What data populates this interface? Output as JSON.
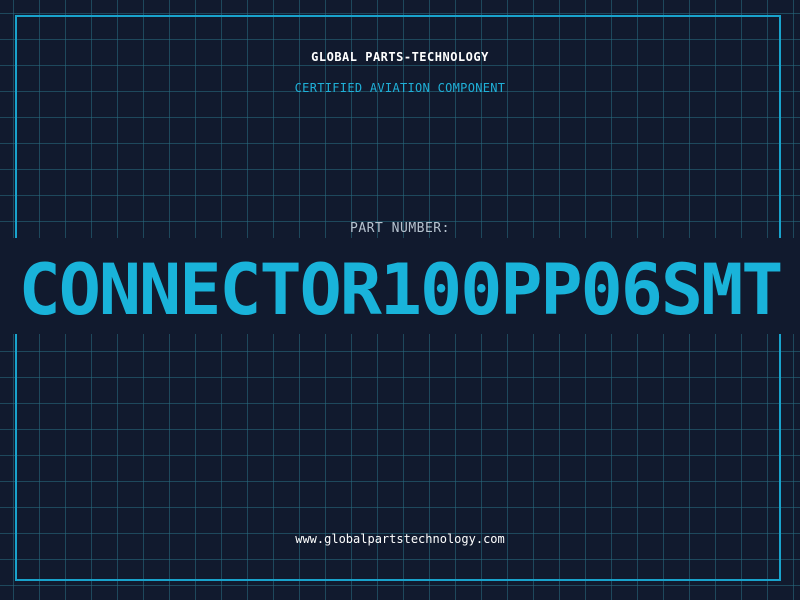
{
  "header": {
    "company": "GLOBAL PARTS-TECHNOLOGY",
    "subtitle": "CERTIFIED AVIATION COMPONENT"
  },
  "part": {
    "label": "PART NUMBER:",
    "number": "CONNECTOR100PP06SMT"
  },
  "footer": {
    "url": "www.globalpartstechnology.com"
  },
  "colors": {
    "background": "#111a2e",
    "grid": "#286e82",
    "accent": "#19b3da",
    "frame": "#19a3cc"
  }
}
